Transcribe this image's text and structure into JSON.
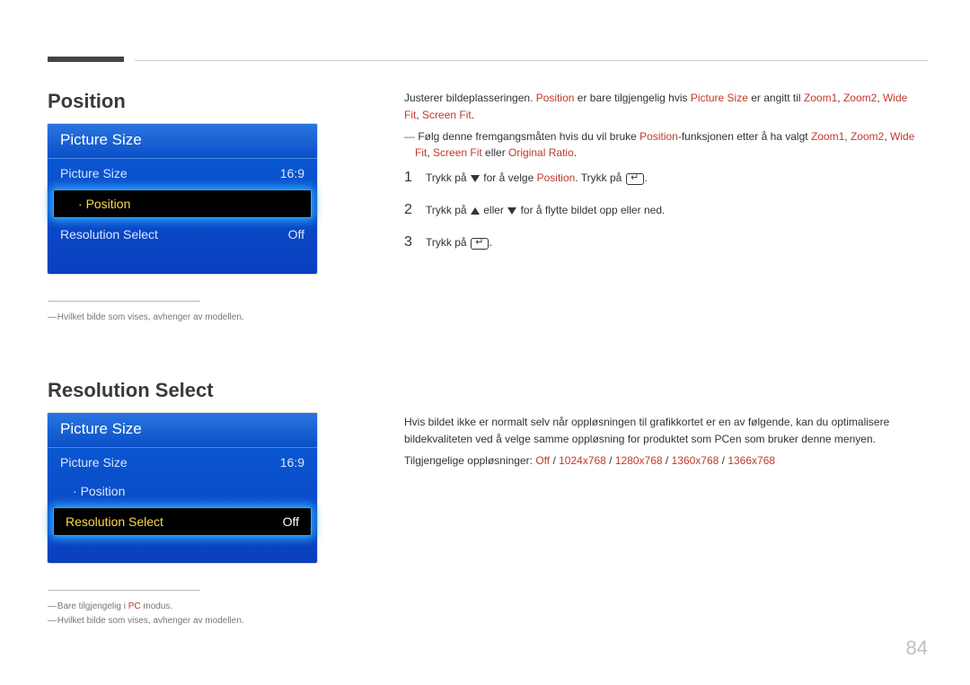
{
  "page_number": "84",
  "section1": {
    "title": "Position",
    "menu": {
      "header": "Picture Size",
      "rows": [
        {
          "label": "Picture Size",
          "value": "16:9",
          "selected": false,
          "sub": false
        },
        {
          "label": "Position",
          "value": "",
          "selected": true,
          "sub": true
        },
        {
          "label": "Resolution Select",
          "value": "Off",
          "selected": false,
          "sub": false
        }
      ]
    },
    "footnotes": [
      "Hvilket bilde som vises, avhenger av modellen."
    ],
    "desc": {
      "intro1": "Justerer bildeplasseringen. ",
      "intro2_a": "Position",
      "intro2_b": " er bare tilgjengelig hvis ",
      "intro2_c": "Picture Size",
      "intro2_d": " er angitt til ",
      "intro2_e": "Zoom1",
      "intro2_f": ", ",
      "intro2_g": "Zoom2",
      "intro2_h": ", ",
      "intro2_i": "Wide Fit",
      "intro2_j": ", ",
      "intro2_k": "Screen Fit",
      "intro2_l": ".",
      "note_a": "Følg denne fremgangsmåten hvis du vil bruke ",
      "note_b": "Position",
      "note_c": "-funksjonen etter å ha valgt ",
      "note_d": "Zoom1",
      "note_e": ", ",
      "note_f": "Zoom2",
      "note_g": ", ",
      "note_h": "Wide Fit",
      "note_i": ", ",
      "note_j": "Screen Fit",
      "note_k": " eller ",
      "note_l": "Original Ratio",
      "note_m": ".",
      "step1_a": "Trykk på ",
      "step1_b": " for å velge ",
      "step1_c": "Position",
      "step1_d": ". Trykk på ",
      "step1_e": ".",
      "step2_a": "Trykk på ",
      "step2_b": " eller ",
      "step2_c": " for å flytte bildet opp eller ned.",
      "step3_a": "Trykk på ",
      "step3_b": "."
    }
  },
  "section2": {
    "title": "Resolution Select",
    "menu": {
      "header": "Picture Size",
      "rows": [
        {
          "label": "Picture Size",
          "value": "16:9",
          "selected": false,
          "sub": false
        },
        {
          "label": "Position",
          "value": "",
          "selected": false,
          "sub": true
        },
        {
          "label": "Resolution Select",
          "value": "Off",
          "selected": true,
          "sub": false
        }
      ]
    },
    "footnotes": [
      {
        "pre": "Bare tilgjengelig i ",
        "pc": "PC",
        "post": " modus."
      },
      {
        "pre": "Hvilket bilde som vises, avhenger av modellen.",
        "pc": "",
        "post": ""
      }
    ],
    "desc": {
      "p1": "Hvis bildet ikke er normalt selv når oppløsningen til grafikkortet er en av følgende, kan du optimalisere bildekvaliteten ved å velge samme oppløsning for produktet som PCen som bruker denne menyen.",
      "p2_a": "Tilgjengelige oppløsninger: ",
      "p2_b": "Off",
      "p2_c": " / ",
      "p2_d": "1024x768",
      "p2_e": " / ",
      "p2_f": "1280x768",
      "p2_g": " / ",
      "p2_h": "1360x768",
      "p2_i": " / ",
      "p2_j": "1366x768"
    }
  }
}
